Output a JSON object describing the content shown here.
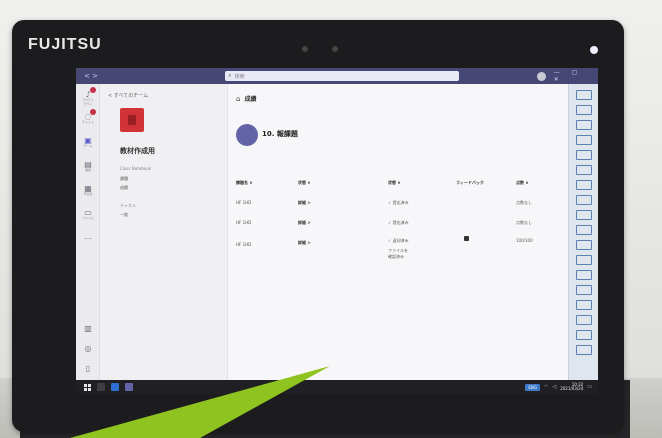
{
  "device": {
    "brand": "FUJITSU"
  },
  "app": {
    "titlebar": {
      "nav_arrows": "< >",
      "search_placeholder": "検索",
      "window_controls": "— ▢ ✕"
    },
    "rail": {
      "items": [
        {
          "icon": "bell-icon",
          "label": "アクティビティ"
        },
        {
          "icon": "chat-icon",
          "label": "チャット"
        },
        {
          "icon": "teams-icon",
          "label": "チーム"
        },
        {
          "icon": "assignments-icon",
          "label": "課題"
        },
        {
          "icon": "calendar-icon",
          "label": "予定表"
        },
        {
          "icon": "files-icon",
          "label": "ファイル"
        },
        {
          "icon": "more-icon",
          "label": "…"
        },
        {
          "icon": "apps-icon",
          "label": ""
        },
        {
          "icon": "help-icon",
          "label": ""
        },
        {
          "icon": "device-icon",
          "label": ""
        }
      ]
    },
    "sidebar": {
      "back_label": "< すべてのチーム",
      "team_name": "教材作成用",
      "items": [
        {
          "text": "Class Notebook",
          "header": true
        },
        {
          "text": "課題",
          "header": false
        },
        {
          "text": "成績",
          "header": false
        },
        {
          "text": "チャネル",
          "header": true
        },
        {
          "text": "一般",
          "header": false
        }
      ]
    },
    "main": {
      "section_title": "成績",
      "assignment_title": "10. 報課題",
      "columns": [
        "課題名 ∨",
        "状態 ∨",
        "状態 ∨",
        "フィードバック",
        "点数 ∨"
      ],
      "rows": [
        {
          "name": "HF 1HD",
          "detail": "詳細 >",
          "status": "✓ 提出済み",
          "feedback": "",
          "score": "点数なし"
        },
        {
          "name": "HF 1HD",
          "detail": "詳細 >",
          "status": "✓ 提出済み",
          "feedback": "",
          "score": "点数なし"
        },
        {
          "name": "HF 1HD",
          "detail": "詳細 >",
          "status": "✓ 返却済み",
          "feedback": "",
          "score": "100/100"
        }
      ],
      "row_extra_note": "ファイルを",
      "row_extra_note2": "確認済み"
    },
    "right_rail_count": 18,
    "taskbar": {
      "lang_label": "ENG",
      "time": "10:32",
      "date": "2021/03/24"
    }
  }
}
